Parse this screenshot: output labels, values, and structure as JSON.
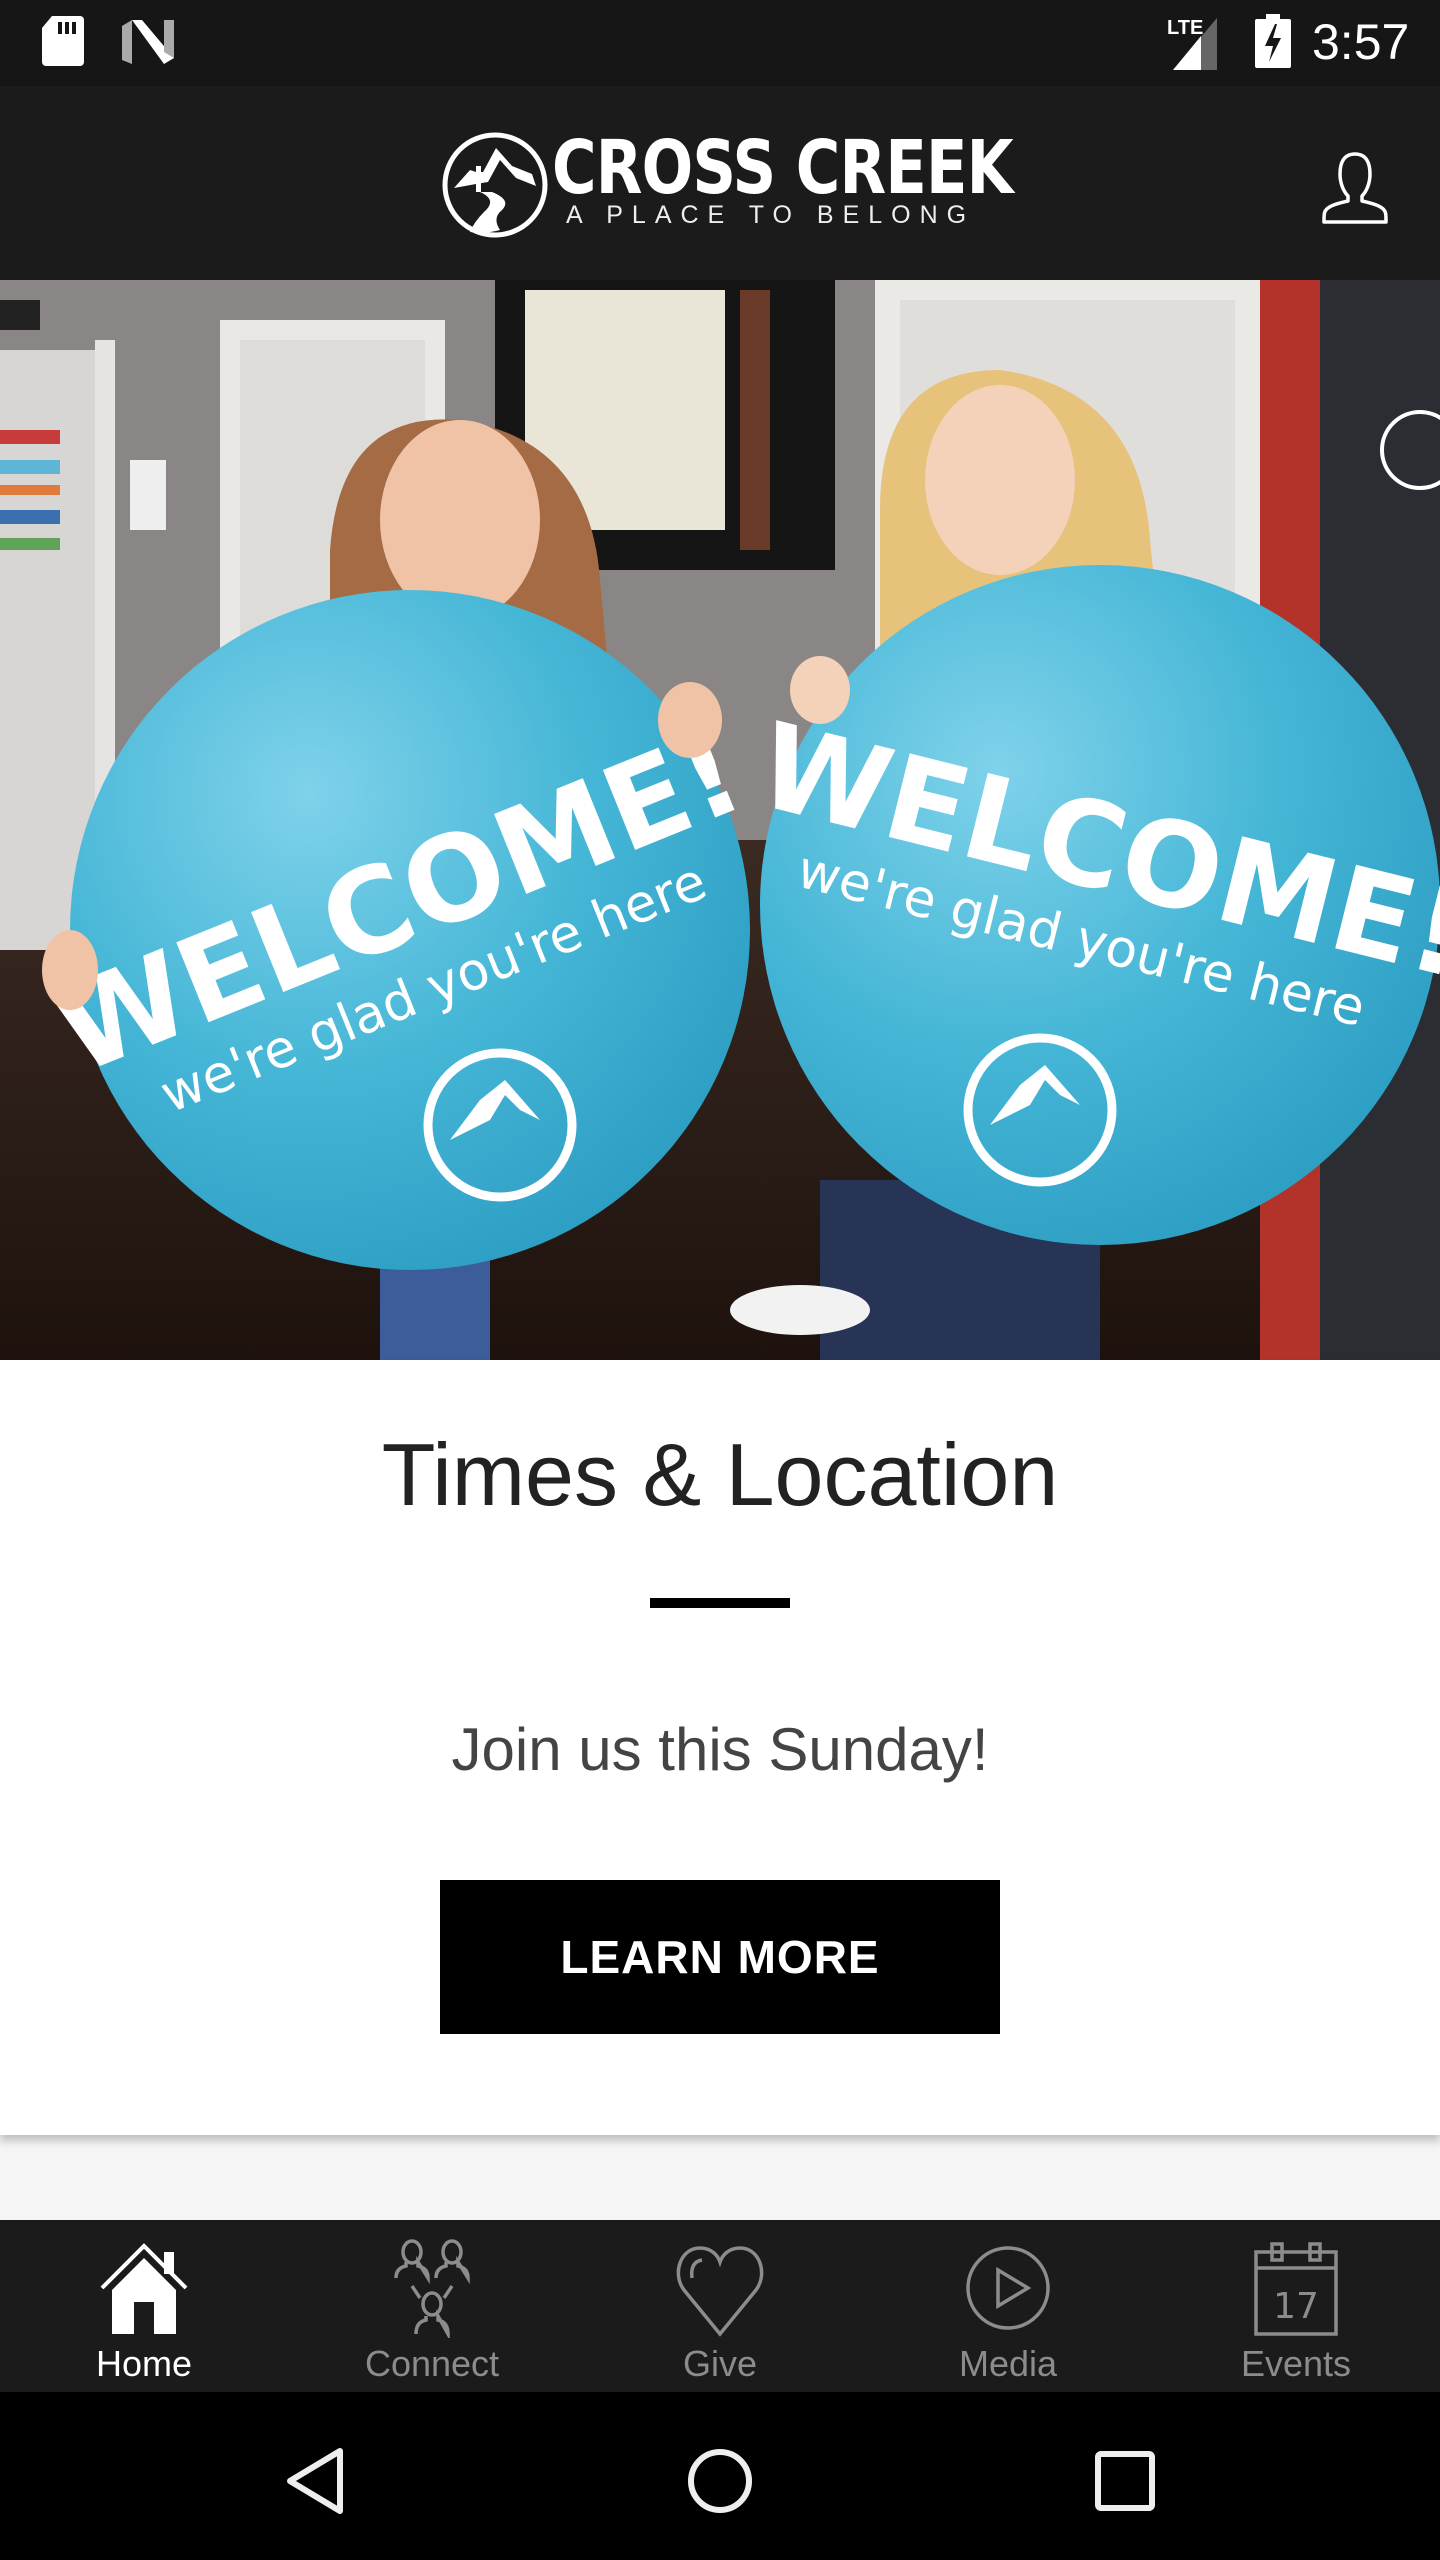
{
  "status_bar": {
    "time": "3:57",
    "network": "LTE",
    "icons": [
      "sd-card-icon",
      "n-notification-icon",
      "lte-signal-icon",
      "battery-charging-icon"
    ]
  },
  "header": {
    "brand_name": "CROSS CREEK",
    "tagline": "A PLACE TO BELONG",
    "profile_icon": "user-profile-icon"
  },
  "hero": {
    "description": "Two girls holding blue round signs",
    "sign_headline": "WELCOME!",
    "sign_subline": "we're glad you're here",
    "sign_color": "#3fb3d2"
  },
  "card": {
    "title": "Times & Location",
    "subtitle": "Join us this Sunday!",
    "button_label": "LEARN MORE"
  },
  "tabs": [
    {
      "label": "Home",
      "icon": "home-icon",
      "active": true
    },
    {
      "label": "Connect",
      "icon": "people-group-icon",
      "active": false
    },
    {
      "label": "Give",
      "icon": "heart-icon",
      "active": false
    },
    {
      "label": "Media",
      "icon": "play-circle-icon",
      "active": false
    },
    {
      "label": "Events",
      "icon": "calendar-icon",
      "active": false,
      "calendar_day": "17"
    }
  ],
  "nav": {
    "back_icon": "back-triangle-icon",
    "home_icon": "home-circle-icon",
    "recents_icon": "recents-square-icon"
  },
  "colors": {
    "header_bg": "#1b1b1b",
    "tab_active": "#ffffff",
    "tab_inactive": "#8c8c8c",
    "button_bg": "#000000"
  }
}
